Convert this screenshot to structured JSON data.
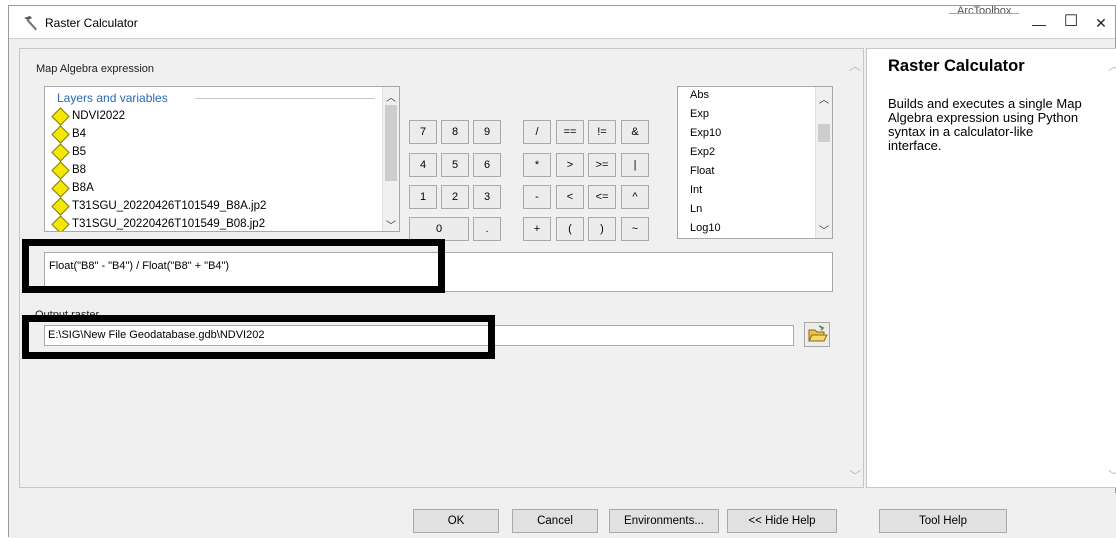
{
  "window": {
    "title": "Raster Calculator",
    "background_tab": "ArcToolbox",
    "minimize_glyph": "—",
    "maximize_glyph": "☐",
    "close_glyph": "✕"
  },
  "calculator": {
    "expression_label": "Map Algebra expression",
    "layers_header": "Layers and variables",
    "layers": [
      "NDVI2022",
      "B4",
      "B5",
      "B8",
      "B8A",
      "T31SGU_20220426T101549_B8A.jp2",
      "T31SGU_20220426T101549_B08.jp2"
    ],
    "buttons": {
      "row1": [
        "7",
        "8",
        "9",
        "/",
        "==",
        "!=",
        "&"
      ],
      "row2": [
        "4",
        "5",
        "6",
        "*",
        ">",
        ">=",
        "|"
      ],
      "row3": [
        "1",
        "2",
        "3",
        "-",
        "<",
        "<=",
        "^"
      ],
      "row4": [
        "0",
        ".",
        "+",
        "(",
        ")",
        "~"
      ]
    },
    "functions": [
      "Abs",
      "Exp",
      "Exp10",
      "Exp2",
      "Float",
      "Int",
      "Ln",
      "Log10"
    ],
    "expression": "Float(\"B8\" - \"B4\") / Float(\"B8\" + \"B4\")",
    "output_label": "Output raster",
    "output_value": "E:\\SIG\\New File Geodatabase.gdb\\NDVI202"
  },
  "help": {
    "title": "Raster Calculator",
    "body": "Builds and executes a single Map Algebra expression using Python syntax in a calculator-like interface."
  },
  "footer": {
    "ok": "OK",
    "cancel": "Cancel",
    "environments": "Environments...",
    "hide_help": "<< Hide Help",
    "tool_help": "Tool Help"
  },
  "icons": {
    "title": "hammer-icon",
    "browse": "open-folder-icon",
    "layer": "raster-layer-diamond-icon"
  },
  "colors": {
    "annotation_outline": "#000000",
    "layer_diamond": "#f3e800",
    "layers_header_text": "#2a6ab8"
  }
}
